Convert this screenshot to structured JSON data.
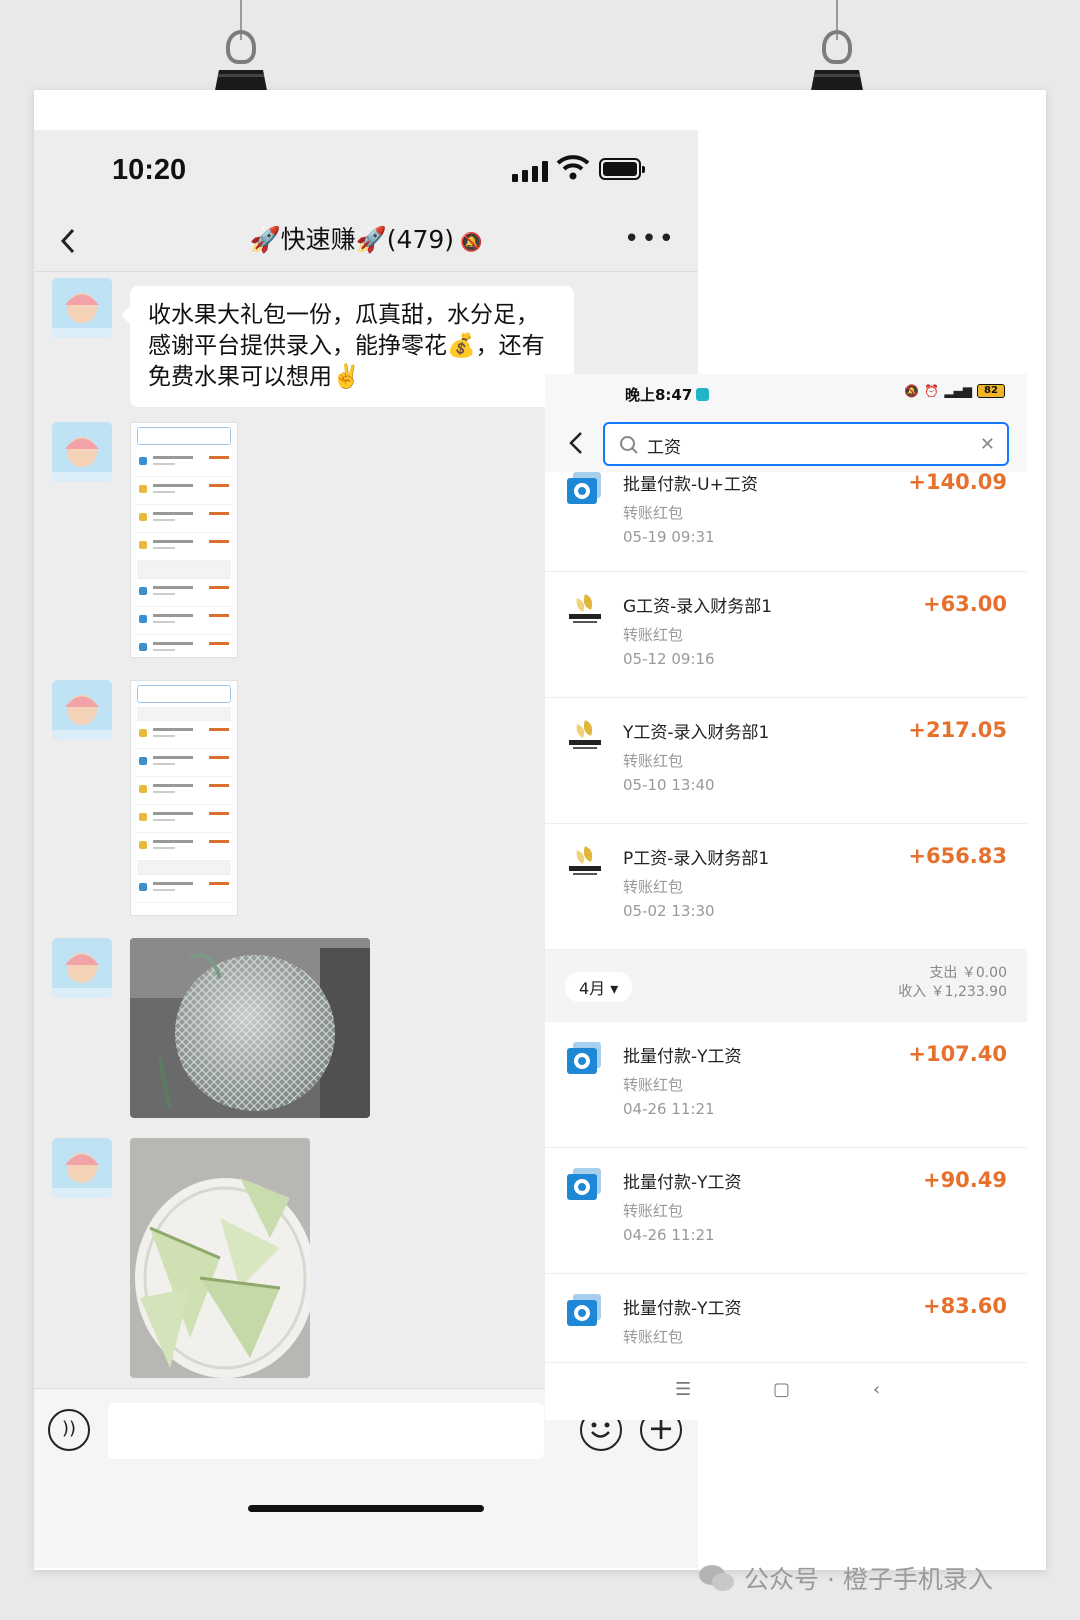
{
  "chat": {
    "status_time": "10:20",
    "title": "🚀快速赚🚀(479)",
    "message_text": "收水果大礼包一份，瓜真甜，水分足，感谢平台提供录入，能挣零花💰，还有免费水果可以想用✌️"
  },
  "bill": {
    "status_time": "晚上8:47",
    "battery": "82",
    "search_query": "工资",
    "items_may": [
      {
        "name": "批量付款-U+工资",
        "sub": "转账红包",
        "date": "05-19 09:31",
        "amount": "+140.09",
        "icon": "alipay-transfer-icon"
      },
      {
        "name": "G工资-录入财务部1",
        "sub": "转账红包",
        "date": "05-12 09:16",
        "amount": "+63.00",
        "icon": "team-logo-icon"
      },
      {
        "name": "Y工资-录入财务部1",
        "sub": "转账红包",
        "date": "05-10 13:40",
        "amount": "+217.05",
        "icon": "team-logo-icon"
      },
      {
        "name": "P工资-录入财务部1",
        "sub": "转账红包",
        "date": "05-02 13:30",
        "amount": "+656.83",
        "icon": "team-logo-icon"
      }
    ],
    "month": {
      "label": "4月",
      "expense": "支出 ￥0.00",
      "income": "收入 ￥1,233.90"
    },
    "items_april": [
      {
        "name": "批量付款-Y工资",
        "sub": "转账红包",
        "date": "04-26 11:21",
        "amount": "+107.40",
        "icon": "alipay-transfer-icon"
      },
      {
        "name": "批量付款-Y工资",
        "sub": "转账红包",
        "date": "04-26 11:21",
        "amount": "+90.49",
        "icon": "alipay-transfer-icon"
      },
      {
        "name": "批量付款-Y工资",
        "sub": "转账红包",
        "date": "",
        "amount": "+83.60",
        "icon": "alipay-transfer-icon"
      }
    ]
  },
  "watermark": "公众号 · 橙子手机录入",
  "colors": {
    "amount": "#e6702e",
    "search_border": "#1677ff",
    "chat_bg": "#ededed"
  }
}
